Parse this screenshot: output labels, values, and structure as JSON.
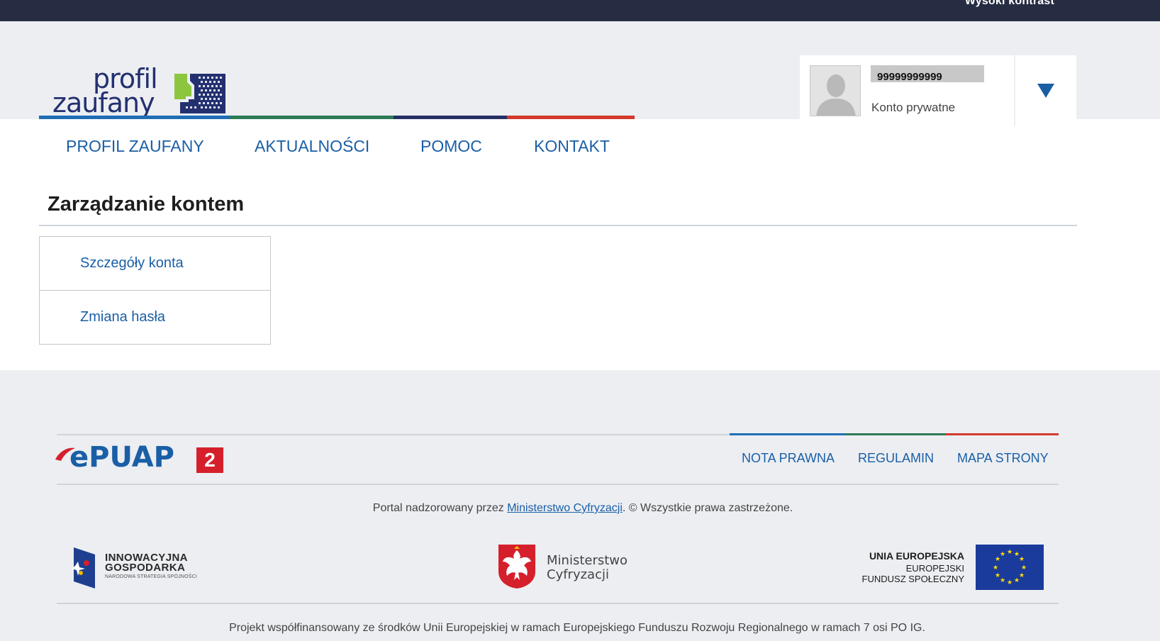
{
  "topbar": {
    "contrast_label": "Wysoki kontrast"
  },
  "logo": {
    "line1": "profil",
    "line2": "zaufany"
  },
  "user": {
    "id": "99999999999",
    "account_type": "Konto prywatne"
  },
  "nav": {
    "items": [
      {
        "label": "PROFIL ZAUFANY",
        "color": "#1f6eb5"
      },
      {
        "label": "AKTUALNOŚCI",
        "color": "#2a7a56"
      },
      {
        "label": "POMOC",
        "color": "#243063"
      },
      {
        "label": "KONTAKT",
        "color": "#d33a2c"
      }
    ]
  },
  "page": {
    "title": "Zarządzanie kontem"
  },
  "side_menu": {
    "items": [
      "Szczegóły konta",
      "Zmiana hasła"
    ]
  },
  "footer": {
    "epuap_text": "ePUAP",
    "epuap_badge": "2",
    "links": [
      "NOTA PRAWNA",
      "REGULAMIN",
      "MAPA STRONY"
    ],
    "portal_prefix": "Portal nadzorowany przez ",
    "portal_link": "Ministerstwo Cyfryzacji",
    "portal_suffix": ". © Wszystkie prawa zastrzeżone.",
    "ig_line1": "INNOWACYJNA",
    "ig_line2": "GOSPODARKA",
    "ig_line3": "NARODOWA STRATEGIA SPÓJNOŚCI",
    "mc_line1": "Ministerstwo",
    "mc_line2": "Cyfryzacji",
    "eu_line1": "UNIA EUROPEJSKA",
    "eu_line2": "EUROPEJSKI",
    "eu_line3": "FUNDUSZ SPOŁECZNY",
    "project": "Projekt współfinansowany ze środków Unii Europejskiej w ramach Europejskiego Funduszu Rozwoju Regionalnego w ramach 7 osi PO IG."
  },
  "colors": {
    "accent_blue": "#1a5fa6",
    "navy": "#233070",
    "green": "#8cc63f",
    "red": "#d5202c",
    "eu_blue": "#1a3b9c",
    "eu_star": "#ffdd00"
  }
}
